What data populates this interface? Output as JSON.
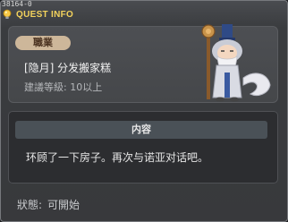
{
  "window": {
    "quest_id": "38164-0",
    "title": "QUEST INFO"
  },
  "quest": {
    "category": "職業",
    "name": "[隐月] 分发搬家糕",
    "level_req": "建議等級: 10以上"
  },
  "content": {
    "header": "内容",
    "text": "环顾了一下房子。再次与诺亚对话吧。"
  },
  "status": {
    "label": "狀態:",
    "value": "可開始"
  },
  "icons": {
    "title_icon": "lightbulb-icon",
    "npc": "npc-elder-portrait"
  },
  "colors": {
    "title": "#f3d25c",
    "category_tag_bg": "#cdb79a",
    "content_header_bg": "#4a5157"
  }
}
